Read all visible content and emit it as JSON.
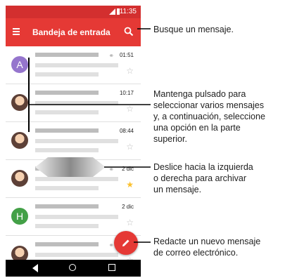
{
  "status": {
    "time": "11:35"
  },
  "appbar": {
    "title": "Bandeja de entrada",
    "menu_icon": "hamburger-menu-icon",
    "search_icon": "search-icon"
  },
  "rows": [
    {
      "avatar": "A",
      "date": "01:51",
      "attachment": true,
      "starred": false
    },
    {
      "avatar": "",
      "date": "10:17",
      "attachment": false,
      "starred": false
    },
    {
      "avatar": "",
      "date": "08:44",
      "attachment": false,
      "starred": false
    },
    {
      "avatar": "",
      "date": "2 dic",
      "attachment": true,
      "starred": true
    },
    {
      "avatar": "H",
      "date": "2 dic",
      "attachment": false,
      "starred": false
    },
    {
      "avatar": "",
      "date": "",
      "attachment": true,
      "starred": false
    }
  ],
  "fab": {
    "icon": "pencil-icon"
  },
  "navbar": {
    "icons": [
      "back-icon",
      "home-icon",
      "recents-icon"
    ]
  },
  "callouts": {
    "search": "Busque un mensaje.",
    "select": [
      "Mantenga pulsado para",
      "seleccionar varios mensajes",
      "y, a continuación, seleccione",
      "una opción en la parte",
      "superior."
    ],
    "swipe": [
      "Deslice hacia la izquierda",
      "o derecha para archivar",
      "un mensaje."
    ],
    "compose": [
      "Redacte un nuevo mensaje",
      "de correo electrónico."
    ]
  },
  "colors": {
    "primary": "#e53935",
    "status_bar": "#d32f2f",
    "star_on": "#fbc02d"
  }
}
